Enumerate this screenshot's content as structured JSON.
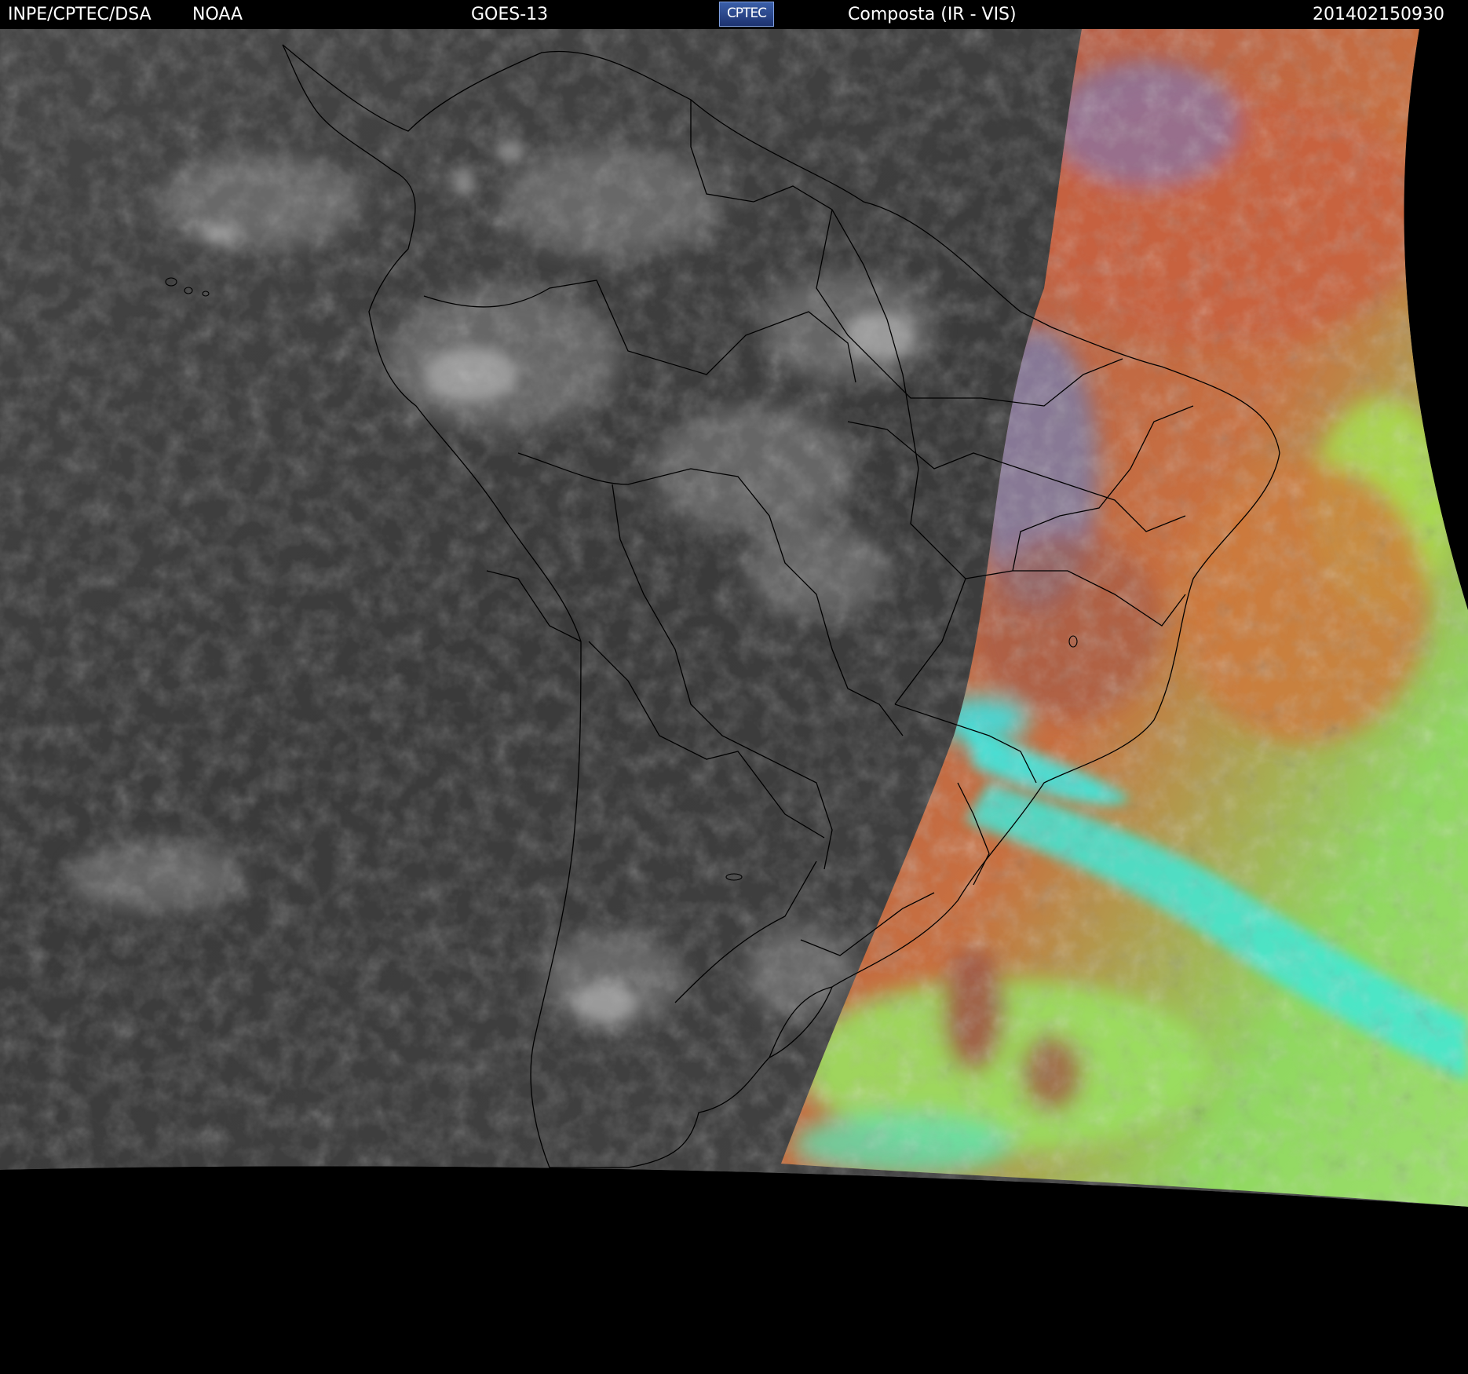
{
  "header": {
    "organization": "INPE/CPTEC/DSA",
    "agency": "NOAA",
    "satellite": "GOES-13",
    "logo_text": "CPTEC",
    "product": "Composta (IR - VIS)",
    "timestamp": "201402150930"
  },
  "colors": {
    "background": "#000000",
    "header_text": "#ffffff",
    "border_lines": "#000000",
    "ir_ocean": "#3c3c3c",
    "ir_cloud": "#9a9a9a",
    "vis_red": "#b85a3c",
    "vis_green": "#9be85a",
    "vis_cyan": "#3ee8d8",
    "vis_blue": "#4a7ad8"
  }
}
